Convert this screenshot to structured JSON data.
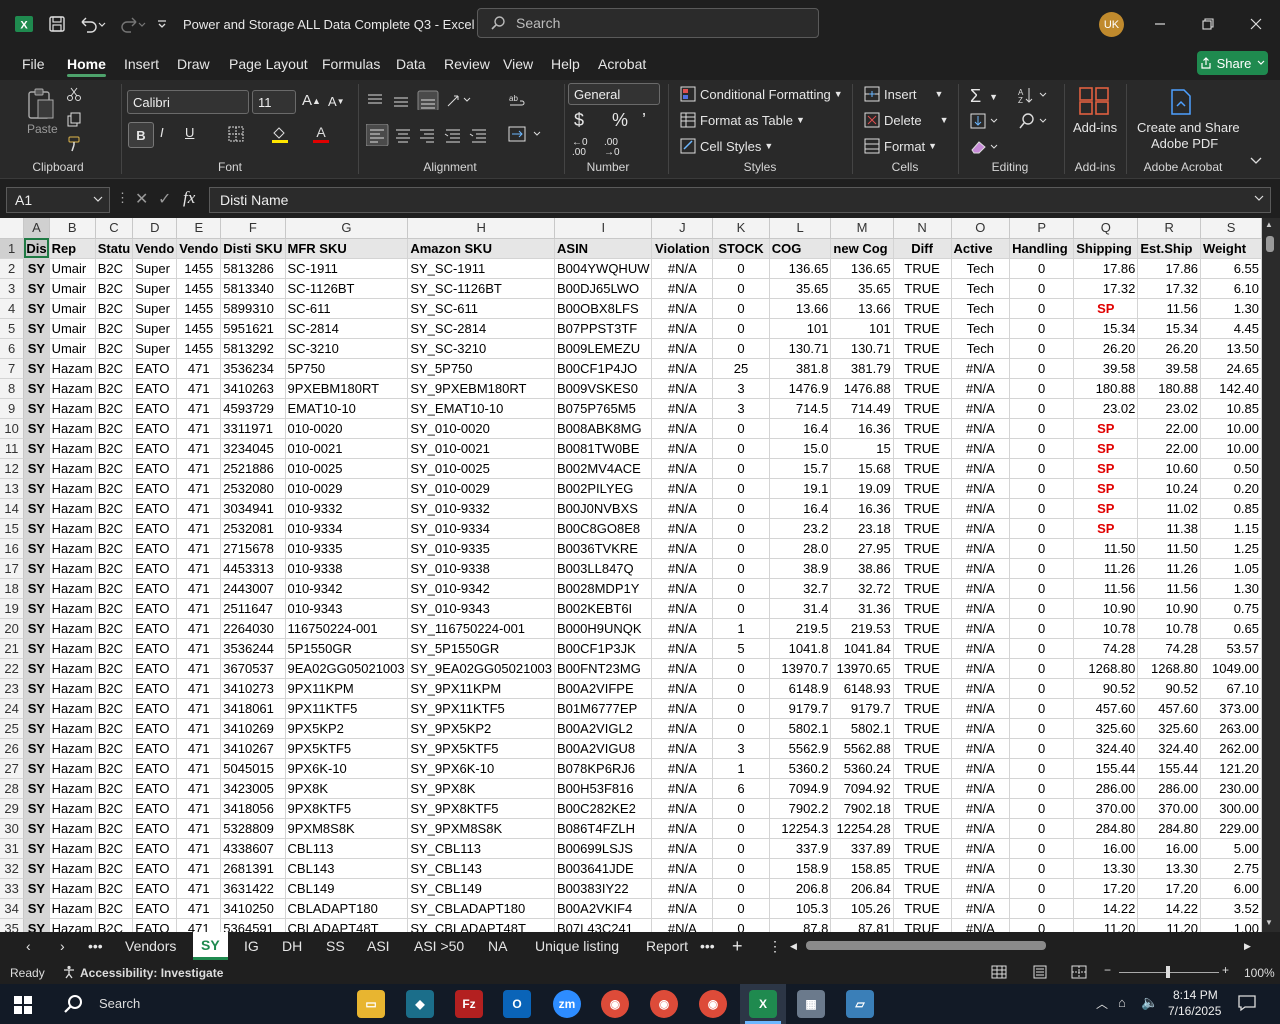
{
  "window": {
    "title": "Power and Storage ALL Data Complete Q3  -  Excel",
    "search_placeholder": "Search",
    "user_initials": "UK"
  },
  "menu": {
    "items": [
      "File",
      "Home",
      "Insert",
      "Draw",
      "Page Layout",
      "Formulas",
      "Data",
      "Review",
      "View",
      "Help",
      "Acrobat"
    ],
    "active": "Home",
    "share_label": "Share"
  },
  "ribbon": {
    "clipboard": {
      "paste_label": "Paste",
      "group_label": "Clipboard"
    },
    "font": {
      "name": "Calibri",
      "size": "11",
      "group_label": "Font"
    },
    "alignment": {
      "group_label": "Alignment"
    },
    "number": {
      "format": "General",
      "group_label": "Number"
    },
    "styles": {
      "conditional": "Conditional Formatting",
      "format_table": "Format as Table",
      "cell_styles": "Cell Styles",
      "group_label": "Styles"
    },
    "cells": {
      "insert": "Insert",
      "delete": "Delete",
      "format": "Format",
      "group_label": "Cells"
    },
    "editing": {
      "group_label": "Editing"
    },
    "addins": {
      "label": "Add-ins",
      "group_label": "Add-ins"
    },
    "adobe": {
      "label1": "Create and Share",
      "label2": "Adobe PDF",
      "group_label": "Adobe Acrobat"
    }
  },
  "formula_bar": {
    "name_box": "A1",
    "content": "Disti Name"
  },
  "sheet": {
    "columns": [
      "A",
      "B",
      "C",
      "D",
      "E",
      "F",
      "G",
      "H",
      "I",
      "J",
      "K",
      "L",
      "M",
      "N",
      "O",
      "P",
      "Q",
      "R",
      "S"
    ],
    "header_row": [
      "Dis",
      "Rep",
      "Statu",
      "Vendo",
      "Vendo",
      "Disti SKU",
      "MFR SKU",
      "Amazon SKU",
      "ASIN",
      "Violation",
      "STOCK",
      "COG",
      "new Cog",
      "Diff",
      "Active",
      "Handling",
      "Shipping",
      "Est.Ship",
      "Weight"
    ],
    "rows": [
      [
        "SY",
        "Umair",
        "B2C",
        "Super",
        "1455",
        "5813286",
        "SC-1911",
        "SY_SC-1911",
        "B004YWQHUW",
        "#N/A",
        "0",
        "136.65",
        "136.65",
        "TRUE",
        "Tech",
        "0",
        "17.86",
        "17.86",
        "6.55"
      ],
      [
        "SY",
        "Umair",
        "B2C",
        "Super",
        "1455",
        "5813340",
        "SC-1126BT",
        "SY_SC-1126BT",
        "B00DJ65LWO",
        "#N/A",
        "0",
        "35.65",
        "35.65",
        "TRUE",
        "Tech",
        "0",
        "17.32",
        "17.32",
        "6.10"
      ],
      [
        "SY",
        "Umair",
        "B2C",
        "Super",
        "1455",
        "5899310",
        "SC-611",
        "SY_SC-611",
        "B00OBX8LFS",
        "#N/A",
        "0",
        "13.66",
        "13.66",
        "TRUE",
        "Tech",
        "0",
        "SP",
        "11.56",
        "1.30"
      ],
      [
        "SY",
        "Umair",
        "B2C",
        "Super",
        "1455",
        "5951621",
        "SC-2814",
        "SY_SC-2814",
        "B07PPST3TF",
        "#N/A",
        "0",
        "101",
        "101",
        "TRUE",
        "Tech",
        "0",
        "15.34",
        "15.34",
        "4.45"
      ],
      [
        "SY",
        "Umair",
        "B2C",
        "Super",
        "1455",
        "5813292",
        "SC-3210",
        "SY_SC-3210",
        "B009LEMEZU",
        "#N/A",
        "0",
        "130.71",
        "130.71",
        "TRUE",
        "Tech",
        "0",
        "26.20",
        "26.20",
        "13.50"
      ],
      [
        "SY",
        "Hazam",
        "B2C",
        "EATO",
        "471",
        "3536234",
        "5P750",
        "SY_5P750",
        "B00CF1P4JO",
        "#N/A",
        "25",
        "381.8",
        "381.79",
        "TRUE",
        "#N/A",
        "0",
        "39.58",
        "39.58",
        "24.65"
      ],
      [
        "SY",
        "Hazam",
        "B2C",
        "EATO",
        "471",
        "3410263",
        "9PXEBM180RT",
        "SY_9PXEBM180RT",
        "B009VSKES0",
        "#N/A",
        "3",
        "1476.9",
        "1476.88",
        "TRUE",
        "#N/A",
        "0",
        "180.88",
        "180.88",
        "142.40"
      ],
      [
        "SY",
        "Hazam",
        "B2C",
        "EATO",
        "471",
        "4593729",
        "EMAT10-10",
        "SY_EMAT10-10",
        "B075P765M5",
        "#N/A",
        "3",
        "714.5",
        "714.49",
        "TRUE",
        "#N/A",
        "0",
        "23.02",
        "23.02",
        "10.85"
      ],
      [
        "SY",
        "Hazam",
        "B2C",
        "EATO",
        "471",
        "3311971",
        "010-0020",
        "SY_010-0020",
        "B008ABK8MG",
        "#N/A",
        "0",
        "16.4",
        "16.36",
        "TRUE",
        "#N/A",
        "0",
        "SP",
        "22.00",
        "10.00"
      ],
      [
        "SY",
        "Hazam",
        "B2C",
        "EATO",
        "471",
        "3234045",
        "010-0021",
        "SY_010-0021",
        "B0081TW0BE",
        "#N/A",
        "0",
        "15.0",
        "15",
        "TRUE",
        "#N/A",
        "0",
        "SP",
        "22.00",
        "10.00"
      ],
      [
        "SY",
        "Hazam",
        "B2C",
        "EATO",
        "471",
        "2521886",
        "010-0025",
        "SY_010-0025",
        "B002MV4ACE",
        "#N/A",
        "0",
        "15.7",
        "15.68",
        "TRUE",
        "#N/A",
        "0",
        "SP",
        "10.60",
        "0.50"
      ],
      [
        "SY",
        "Hazam",
        "B2C",
        "EATO",
        "471",
        "2532080",
        "010-0029",
        "SY_010-0029",
        "B002PILYEG",
        "#N/A",
        "0",
        "19.1",
        "19.09",
        "TRUE",
        "#N/A",
        "0",
        "SP",
        "10.24",
        "0.20"
      ],
      [
        "SY",
        "Hazam",
        "B2C",
        "EATO",
        "471",
        "3034941",
        "010-9332",
        "SY_010-9332",
        "B00J0NVBXS",
        "#N/A",
        "0",
        "16.4",
        "16.36",
        "TRUE",
        "#N/A",
        "0",
        "SP",
        "11.02",
        "0.85"
      ],
      [
        "SY",
        "Hazam",
        "B2C",
        "EATO",
        "471",
        "2532081",
        "010-9334",
        "SY_010-9334",
        "B00C8GO8E8",
        "#N/A",
        "0",
        "23.2",
        "23.18",
        "TRUE",
        "#N/A",
        "0",
        "SP",
        "11.38",
        "1.15"
      ],
      [
        "SY",
        "Hazam",
        "B2C",
        "EATO",
        "471",
        "2715678",
        "010-9335",
        "SY_010-9335",
        "B0036TVKRE",
        "#N/A",
        "0",
        "28.0",
        "27.95",
        "TRUE",
        "#N/A",
        "0",
        "11.50",
        "11.50",
        "1.25"
      ],
      [
        "SY",
        "Hazam",
        "B2C",
        "EATO",
        "471",
        "4453313",
        "010-9338",
        "SY_010-9338",
        "B003LL847Q",
        "#N/A",
        "0",
        "38.9",
        "38.86",
        "TRUE",
        "#N/A",
        "0",
        "11.26",
        "11.26",
        "1.05"
      ],
      [
        "SY",
        "Hazam",
        "B2C",
        "EATO",
        "471",
        "2443007",
        "010-9342",
        "SY_010-9342",
        "B0028MDP1Y",
        "#N/A",
        "0",
        "32.7",
        "32.72",
        "TRUE",
        "#N/A",
        "0",
        "11.56",
        "11.56",
        "1.30"
      ],
      [
        "SY",
        "Hazam",
        "B2C",
        "EATO",
        "471",
        "2511647",
        "010-9343",
        "SY_010-9343",
        "B002KEBT6I",
        "#N/A",
        "0",
        "31.4",
        "31.36",
        "TRUE",
        "#N/A",
        "0",
        "10.90",
        "10.90",
        "0.75"
      ],
      [
        "SY",
        "Hazam",
        "B2C",
        "EATO",
        "471",
        "2264030",
        "116750224-001",
        "SY_116750224-001",
        "B000H9UNQK",
        "#N/A",
        "1",
        "219.5",
        "219.53",
        "TRUE",
        "#N/A",
        "0",
        "10.78",
        "10.78",
        "0.65"
      ],
      [
        "SY",
        "Hazam",
        "B2C",
        "EATO",
        "471",
        "3536244",
        "5P1550GR",
        "SY_5P1550GR",
        "B00CF1P3JK",
        "#N/A",
        "5",
        "1041.8",
        "1041.84",
        "TRUE",
        "#N/A",
        "0",
        "74.28",
        "74.28",
        "53.57"
      ],
      [
        "SY",
        "Hazam",
        "B2C",
        "EATO",
        "471",
        "3670537",
        "9EA02GG05021003",
        "SY_9EA02GG05021003",
        "B00FNT23MG",
        "#N/A",
        "0",
        "13970.7",
        "13970.65",
        "TRUE",
        "#N/A",
        "0",
        "1268.80",
        "1268.80",
        "1049.00"
      ],
      [
        "SY",
        "Hazam",
        "B2C",
        "EATO",
        "471",
        "3410273",
        "9PX11KPM",
        "SY_9PX11KPM",
        "B00A2VIFPE",
        "#N/A",
        "0",
        "6148.9",
        "6148.93",
        "TRUE",
        "#N/A",
        "0",
        "90.52",
        "90.52",
        "67.10"
      ],
      [
        "SY",
        "Hazam",
        "B2C",
        "EATO",
        "471",
        "3418061",
        "9PX11KTF5",
        "SY_9PX11KTF5",
        "B01M6777EP",
        "#N/A",
        "0",
        "9179.7",
        "9179.7",
        "TRUE",
        "#N/A",
        "0",
        "457.60",
        "457.60",
        "373.00"
      ],
      [
        "SY",
        "Hazam",
        "B2C",
        "EATO",
        "471",
        "3410269",
        "9PX5KP2",
        "SY_9PX5KP2",
        "B00A2VIGL2",
        "#N/A",
        "0",
        "5802.1",
        "5802.1",
        "TRUE",
        "#N/A",
        "0",
        "325.60",
        "325.60",
        "263.00"
      ],
      [
        "SY",
        "Hazam",
        "B2C",
        "EATO",
        "471",
        "3410267",
        "9PX5KTF5",
        "SY_9PX5KTF5",
        "B00A2VIGU8",
        "#N/A",
        "3",
        "5562.9",
        "5562.88",
        "TRUE",
        "#N/A",
        "0",
        "324.40",
        "324.40",
        "262.00"
      ],
      [
        "SY",
        "Hazam",
        "B2C",
        "EATO",
        "471",
        "5045015",
        "9PX6K-10",
        "SY_9PX6K-10",
        "B078KP6RJ6",
        "#N/A",
        "1",
        "5360.2",
        "5360.24",
        "TRUE",
        "#N/A",
        "0",
        "155.44",
        "155.44",
        "121.20"
      ],
      [
        "SY",
        "Hazam",
        "B2C",
        "EATO",
        "471",
        "3423005",
        "9PX8K",
        "SY_9PX8K",
        "B00H53F816",
        "#N/A",
        "6",
        "7094.9",
        "7094.92",
        "TRUE",
        "#N/A",
        "0",
        "286.00",
        "286.00",
        "230.00"
      ],
      [
        "SY",
        "Hazam",
        "B2C",
        "EATO",
        "471",
        "3418056",
        "9PX8KTF5",
        "SY_9PX8KTF5",
        "B00C282KE2",
        "#N/A",
        "0",
        "7902.2",
        "7902.18",
        "TRUE",
        "#N/A",
        "0",
        "370.00",
        "370.00",
        "300.00"
      ],
      [
        "SY",
        "Hazam",
        "B2C",
        "EATO",
        "471",
        "5328809",
        "9PXM8S8K",
        "SY_9PXM8S8K",
        "B086T4FZLH",
        "#N/A",
        "0",
        "12254.3",
        "12254.28",
        "TRUE",
        "#N/A",
        "0",
        "284.80",
        "284.80",
        "229.00"
      ],
      [
        "SY",
        "Hazam",
        "B2C",
        "EATO",
        "471",
        "4338607",
        "CBL113",
        "SY_CBL113",
        "B00699LSJS",
        "#N/A",
        "0",
        "337.9",
        "337.89",
        "TRUE",
        "#N/A",
        "0",
        "16.00",
        "16.00",
        "5.00"
      ],
      [
        "SY",
        "Hazam",
        "B2C",
        "EATO",
        "471",
        "2681391",
        "CBL143",
        "SY_CBL143",
        "B003641JDE",
        "#N/A",
        "0",
        "158.9",
        "158.85",
        "TRUE",
        "#N/A",
        "0",
        "13.30",
        "13.30",
        "2.75"
      ],
      [
        "SY",
        "Hazam",
        "B2C",
        "EATO",
        "471",
        "3631422",
        "CBL149",
        "SY_CBL149",
        "B00383IY22",
        "#N/A",
        "0",
        "206.8",
        "206.84",
        "TRUE",
        "#N/A",
        "0",
        "17.20",
        "17.20",
        "6.00"
      ],
      [
        "SY",
        "Hazam",
        "B2C",
        "EATO",
        "471",
        "3410250",
        "CBLADAPT180",
        "SY_CBLADAPT180",
        "B00A2VKIF4",
        "#N/A",
        "0",
        "105.3",
        "105.26",
        "TRUE",
        "#N/A",
        "0",
        "14.22",
        "14.22",
        "3.52"
      ],
      [
        "SY",
        "Hazam",
        "B2C",
        "EATO",
        "471",
        "5364591",
        "CBLADAPT48T",
        "SY_CBLADAPT48T",
        "B07L43C241",
        "#N/A",
        "0",
        "87.8",
        "87.81",
        "TRUE",
        "#N/A",
        "0",
        "11.20",
        "11.20",
        "1.00"
      ]
    ]
  },
  "tabs": [
    "Vendors",
    "SY",
    "IG",
    "DH",
    "SS",
    "ASI",
    "ASI >50",
    "NA",
    "Unique listing",
    "Report"
  ],
  "active_tab": "SY",
  "status": {
    "ready": "Ready",
    "accessibility": "Accessibility: Investigate",
    "zoom": "100%"
  },
  "taskbar": {
    "search": "Search",
    "time": "8:14 PM",
    "date": "7/16/2025"
  }
}
